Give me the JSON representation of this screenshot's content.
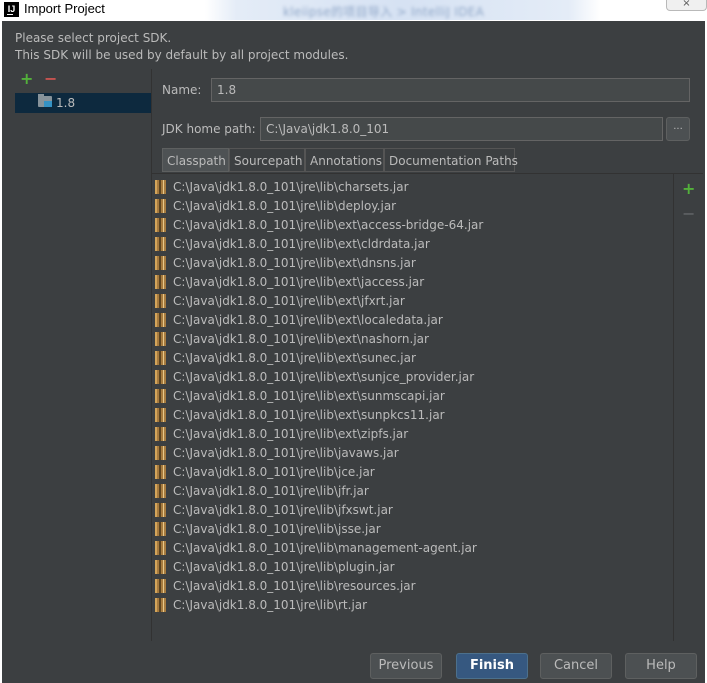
{
  "window": {
    "title": "Import Project",
    "background_caption": "kleiipse的项目导入 > IntelliJ IDEA",
    "close_label": "×"
  },
  "description": {
    "line1": "Please select project SDK.",
    "line2": "This SDK will be used by default by all project modules."
  },
  "sdk_toolbar": {
    "add": "+",
    "remove": "−"
  },
  "sdk_list": {
    "items": [
      {
        "label": "1.8",
        "icon": "folder-sdk-icon"
      }
    ]
  },
  "form": {
    "name_label": "Name:",
    "name_value": "1.8",
    "jdk_home_label": "JDK home path:",
    "jdk_home_value": "C:\\Java\\jdk1.8.0_101",
    "browse_label": "..."
  },
  "tabs": [
    {
      "label": "Classpath",
      "active": true
    },
    {
      "label": "Sourcepath",
      "active": false
    },
    {
      "label": "Annotations",
      "active": false
    },
    {
      "label": "Documentation Paths",
      "active": false
    }
  ],
  "classpath": [
    "C:\\Java\\jdk1.8.0_101\\jre\\lib\\charsets.jar",
    "C:\\Java\\jdk1.8.0_101\\jre\\lib\\deploy.jar",
    "C:\\Java\\jdk1.8.0_101\\jre\\lib\\ext\\access-bridge-64.jar",
    "C:\\Java\\jdk1.8.0_101\\jre\\lib\\ext\\cldrdata.jar",
    "C:\\Java\\jdk1.8.0_101\\jre\\lib\\ext\\dnsns.jar",
    "C:\\Java\\jdk1.8.0_101\\jre\\lib\\ext\\jaccess.jar",
    "C:\\Java\\jdk1.8.0_101\\jre\\lib\\ext\\jfxrt.jar",
    "C:\\Java\\jdk1.8.0_101\\jre\\lib\\ext\\localedata.jar",
    "C:\\Java\\jdk1.8.0_101\\jre\\lib\\ext\\nashorn.jar",
    "C:\\Java\\jdk1.8.0_101\\jre\\lib\\ext\\sunec.jar",
    "C:\\Java\\jdk1.8.0_101\\jre\\lib\\ext\\sunjce_provider.jar",
    "C:\\Java\\jdk1.8.0_101\\jre\\lib\\ext\\sunmscapi.jar",
    "C:\\Java\\jdk1.8.0_101\\jre\\lib\\ext\\sunpkcs11.jar",
    "C:\\Java\\jdk1.8.0_101\\jre\\lib\\ext\\zipfs.jar",
    "C:\\Java\\jdk1.8.0_101\\jre\\lib\\javaws.jar",
    "C:\\Java\\jdk1.8.0_101\\jre\\lib\\jce.jar",
    "C:\\Java\\jdk1.8.0_101\\jre\\lib\\jfr.jar",
    "C:\\Java\\jdk1.8.0_101\\jre\\lib\\jfxswt.jar",
    "C:\\Java\\jdk1.8.0_101\\jre\\lib\\jsse.jar",
    "C:\\Java\\jdk1.8.0_101\\jre\\lib\\management-agent.jar",
    "C:\\Java\\jdk1.8.0_101\\jre\\lib\\plugin.jar",
    "C:\\Java\\jdk1.8.0_101\\jre\\lib\\resources.jar",
    "C:\\Java\\jdk1.8.0_101\\jre\\lib\\rt.jar"
  ],
  "path_toolbar": {
    "add": "+",
    "remove": "−"
  },
  "buttons": {
    "previous": "Previous",
    "finish": "Finish",
    "cancel": "Cancel",
    "help": "Help"
  },
  "colors": {
    "dialog_bg": "#3c3f41",
    "selection": "#0d293e",
    "add_green": "#53b03b",
    "remove_red": "#c75450",
    "primary_button": "#365880"
  }
}
